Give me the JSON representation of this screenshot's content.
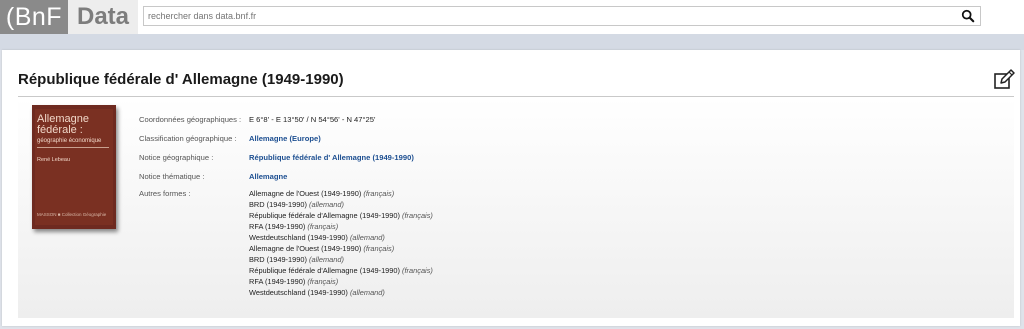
{
  "header": {
    "logo_bnf": "(BnF",
    "logo_data": "Data",
    "search_placeholder": "rechercher dans data.bnf.fr"
  },
  "page": {
    "title": "République fédérale d' Allemagne (1949-1990)"
  },
  "cover": {
    "title": "Allemagne\nfédérale :",
    "subtitle": "géographie économique",
    "author": "René Lebeau",
    "publisher": "MASSON ■ Collection Géographie"
  },
  "details": {
    "coords_label": "Coordonnées géographiques :",
    "coords_value": "E 6°8' - E 13°50' / N 54°56' - N 47°25'",
    "classification_label": "Classification géographique :",
    "classification_value": "Allemagne (Europe)",
    "geo_notice_label": "Notice géographique :",
    "geo_notice_value": "République fédérale d' Allemagne (1949-1990)",
    "thematic_notice_label": "Notice thématique :",
    "thematic_notice_value": "Allemagne",
    "other_forms_label": "Autres formes :"
  },
  "other_forms": [
    {
      "name": "Allemagne de l'Ouest (1949-1990)",
      "lang": "(français)"
    },
    {
      "name": "BRD (1949-1990)",
      "lang": "(allemand)"
    },
    {
      "name": "République fédérale d'Allemagne (1949-1990)",
      "lang": "(français)"
    },
    {
      "name": "RFA (1949-1990)",
      "lang": "(français)"
    },
    {
      "name": "Westdeutschland (1949-1990)",
      "lang": "(allemand)"
    },
    {
      "name": "Allemagne de l'Ouest (1949-1990)",
      "lang": "(français)"
    },
    {
      "name": "BRD (1949-1990)",
      "lang": "(allemand)"
    },
    {
      "name": "République fédérale d'Allemagne (1949-1990)",
      "lang": "(français)"
    },
    {
      "name": "RFA (1949-1990)",
      "lang": "(français)"
    },
    {
      "name": "Westdeutschland (1949-1990)",
      "lang": "(allemand)"
    }
  ],
  "colors": {
    "link": "#1d4f91",
    "logo_bg": "#8a8a8a",
    "cover_bg": "#7a3022"
  }
}
